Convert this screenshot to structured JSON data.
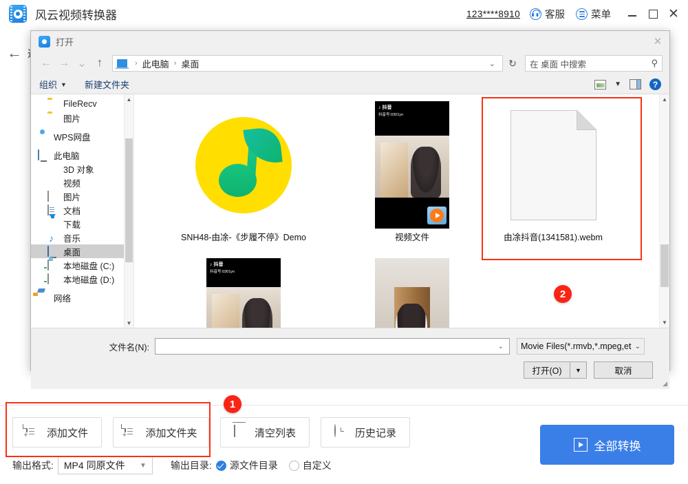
{
  "app": {
    "title": "风云视频转换器",
    "account": "123****8910",
    "support_label": "客服",
    "menu_label": "菜单",
    "back_label": "返回",
    "window_controls": {
      "minimize": "–",
      "maximize": "□",
      "close": "✕"
    }
  },
  "toolbar": {
    "add_file": "添加文件",
    "add_folder": "添加文件夹",
    "clear_list": "清空列表",
    "history": "历史记录",
    "convert_all": "全部转换"
  },
  "options": {
    "format_label": "输出格式:",
    "format_value": "MP4 同原文件",
    "outdir_label": "输出目录:",
    "outdir_source": "源文件目录",
    "outdir_custom": "自定义",
    "outdir_selected": "源文件目录"
  },
  "dialog": {
    "title": "打开",
    "close": "✕",
    "nav": {
      "back": "←",
      "forward": "→",
      "recent": "⌄",
      "up": "↑",
      "refresh": "↻"
    },
    "breadcrumb": [
      "此电脑",
      "桌面"
    ],
    "breadcrumb_sep": "›",
    "search_placeholder": "在 桌面 中搜索",
    "commands": {
      "organize": "组织",
      "organize_caret": "▼",
      "new_folder": "新建文件夹"
    },
    "view_caret": "▼",
    "help": "?",
    "sidebar": [
      {
        "label": "FileRecv",
        "icon": "folder-icon",
        "indent": 1,
        "selected": false
      },
      {
        "label": "图片",
        "icon": "folder-icon",
        "indent": 1,
        "selected": false
      },
      {
        "label": "WPS网盘",
        "icon": "cloud-icon",
        "indent": 0,
        "selected": false
      },
      {
        "label": "此电脑",
        "icon": "computer-icon",
        "indent": 0,
        "selected": false
      },
      {
        "label": "3D 对象",
        "icon": "cube-icon",
        "indent": 1,
        "selected": false
      },
      {
        "label": "视频",
        "icon": "film-icon",
        "indent": 1,
        "selected": false
      },
      {
        "label": "图片",
        "icon": "picture-icon",
        "indent": 1,
        "selected": false
      },
      {
        "label": "文档",
        "icon": "document-icon",
        "indent": 1,
        "selected": false
      },
      {
        "label": "下载",
        "icon": "download-icon",
        "indent": 1,
        "selected": false
      },
      {
        "label": "音乐",
        "icon": "music-note-icon",
        "indent": 1,
        "selected": false
      },
      {
        "label": "桌面",
        "icon": "desktop-icon",
        "indent": 1,
        "selected": true
      },
      {
        "label": "本地磁盘 (C:)",
        "icon": "drive-c-icon",
        "indent": 1,
        "selected": false
      },
      {
        "label": "本地磁盘 (D:)",
        "icon": "drive-icon",
        "indent": 1,
        "selected": false
      },
      {
        "label": "网络",
        "icon": "network-icon",
        "indent": 0,
        "selected": false
      }
    ],
    "files": [
      {
        "name": "SNH48-由凃-《步履不停》Demo",
        "thumb": "qq-music-icon",
        "selected": false
      },
      {
        "name": "视频文件",
        "thumb": "video-thumbnail",
        "selected": false
      },
      {
        "name": "由凃抖音(1341581).webm",
        "thumb": "blank-document-icon",
        "selected": false
      },
      {
        "name": "",
        "thumb": "video-thumbnail",
        "selected": false
      },
      {
        "name": "",
        "thumb": "video-thumbnail",
        "selected": false
      }
    ],
    "filename_label": "文件名(N):",
    "filename_value": "",
    "filter_value": "Movie Files(*.rmvb,*.mpeg,et",
    "open_button": "打开(O)",
    "open_caret": "▼",
    "cancel_button": "取消"
  },
  "annotations": {
    "badge1": "1",
    "badge2": "2",
    "color": "#fb2414"
  },
  "theme": {
    "accent": "#3a7fe8",
    "link": "#1d3f6e",
    "annotation": "#fb2414"
  }
}
